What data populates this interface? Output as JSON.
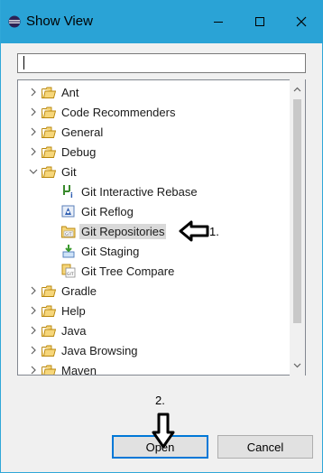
{
  "window": {
    "title": "Show View",
    "title_bar_color": "#2aa3d6",
    "controls": {
      "minimize": "minimize-icon",
      "maximize": "maximize-icon",
      "close": "close-icon"
    }
  },
  "filter": {
    "value": "",
    "placeholder": ""
  },
  "tree": {
    "items": [
      {
        "label": "Ant",
        "expanded": false,
        "icon": "folder-icon"
      },
      {
        "label": "Code Recommenders",
        "expanded": false,
        "icon": "folder-icon"
      },
      {
        "label": "General",
        "expanded": false,
        "icon": "folder-icon"
      },
      {
        "label": "Debug",
        "expanded": false,
        "icon": "folder-icon"
      },
      {
        "label": "Git",
        "expanded": true,
        "icon": "folder-icon",
        "children": [
          {
            "label": "Git Interactive Rebase",
            "icon": "git-rebase-icon"
          },
          {
            "label": "Git Reflog",
            "icon": "git-reflog-icon"
          },
          {
            "label": "Git Repositories",
            "icon": "git-repositories-icon",
            "selected": true
          },
          {
            "label": "Git Staging",
            "icon": "git-staging-icon"
          },
          {
            "label": "Git Tree Compare",
            "icon": "git-tree-compare-icon"
          }
        ]
      },
      {
        "label": "Gradle",
        "expanded": false,
        "icon": "folder-icon"
      },
      {
        "label": "Help",
        "expanded": false,
        "icon": "folder-icon"
      },
      {
        "label": "Java",
        "expanded": false,
        "icon": "folder-icon"
      },
      {
        "label": "Java Browsing",
        "expanded": false,
        "icon": "folder-icon"
      },
      {
        "label": "Maven",
        "expanded": false,
        "icon": "folder-icon"
      }
    ]
  },
  "annotations": {
    "step1": "1.",
    "step2": "2."
  },
  "buttons": {
    "open": "Open",
    "cancel": "Cancel"
  },
  "colors": {
    "selection": "#d9d9d9",
    "focus_border": "#0078d7",
    "folder": "#e8c35a"
  }
}
